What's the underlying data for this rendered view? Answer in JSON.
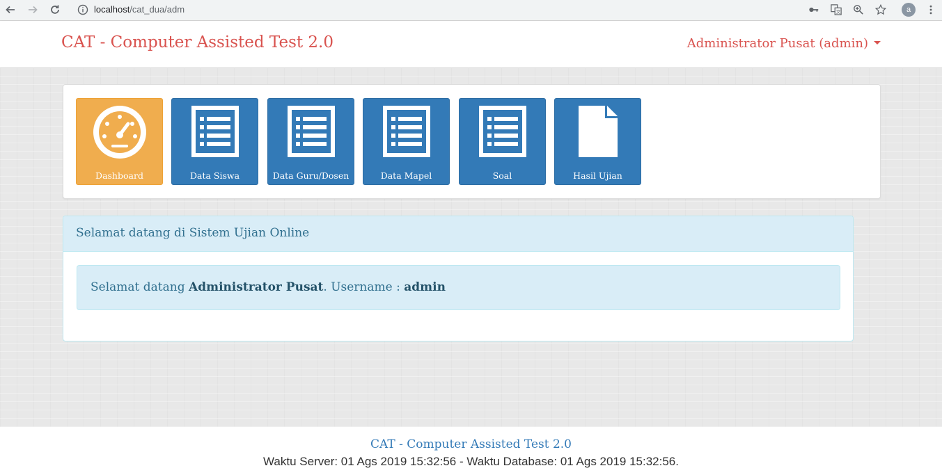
{
  "browser": {
    "url_host": "localhost",
    "url_path": "/cat_dua/adm",
    "avatar_letter": "a"
  },
  "header": {
    "brand": "CAT - Computer Assisted Test 2.0",
    "user_menu": "Administrator Pusat (admin)"
  },
  "menu": {
    "tiles": [
      {
        "label": "Dashboard",
        "icon": "dashboard-icon",
        "color": "#f0ad4e"
      },
      {
        "label": "Data Siswa",
        "icon": "list-icon",
        "color": "#337ab7"
      },
      {
        "label": "Data Guru/Dosen",
        "icon": "list-icon",
        "color": "#337ab7"
      },
      {
        "label": "Data Mapel",
        "icon": "list-icon",
        "color": "#337ab7"
      },
      {
        "label": "Soal",
        "icon": "list-icon",
        "color": "#337ab7"
      },
      {
        "label": "Hasil Ujian",
        "icon": "file-icon",
        "color": "#337ab7"
      }
    ]
  },
  "welcome": {
    "heading": "Selamat datang di Sistem Ujian Online",
    "prefix": "Selamat datang ",
    "name": "Administrator Pusat",
    "middle": ". Username : ",
    "username": "admin"
  },
  "footer": {
    "title": "CAT - Computer Assisted Test 2.0",
    "time": "Waktu Server: 01 Ags 2019 15:32:56 - Waktu Database: 01 Ags 2019 15:32:56."
  }
}
